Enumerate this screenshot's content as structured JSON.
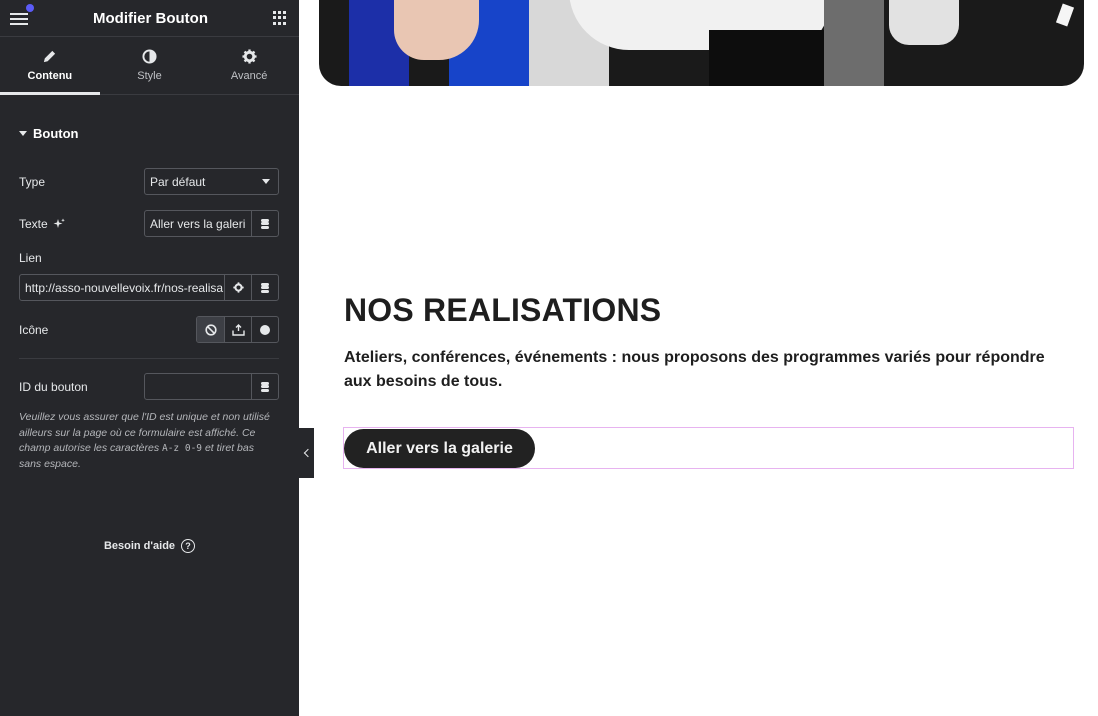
{
  "panel": {
    "title": "Modifier Bouton",
    "tabs": [
      {
        "label": "Contenu",
        "icon": "pencil-icon"
      },
      {
        "label": "Style",
        "icon": "contrast-icon"
      },
      {
        "label": "Avancé",
        "icon": "gear-icon"
      }
    ],
    "section_title": "Bouton",
    "fields": {
      "type_label": "Type",
      "type_value": "Par défaut",
      "texte_label": "Texte",
      "texte_value": "Aller vers la galeri",
      "lien_label": "Lien",
      "lien_value": "http://asso-nouvellevoix.fr/nos-realisa",
      "icone_label": "Icône",
      "id_label": "ID du bouton",
      "id_value": ""
    },
    "help_text": {
      "part1": "Veuillez vous assurer que l'ID est unique et non utilisé ailleurs sur la page où ce formulaire est affiché. Ce champ autorise les caractères ",
      "code": "A-z 0-9",
      "part2": " et tiret bas sans espace."
    },
    "help_link": "Besoin d'aide"
  },
  "canvas": {
    "section_title": "NOS REALISATIONS",
    "description": "Ateliers, conférences, événements : nous proposons des programmes variés pour répondre aux besoins de tous.",
    "button_label": "Aller vers la galerie"
  },
  "colors": {
    "panel_bg": "#26272b",
    "selection_outline": "#e7b3f0",
    "button_bg": "#222222",
    "notification_dot": "#5b5bf7"
  }
}
